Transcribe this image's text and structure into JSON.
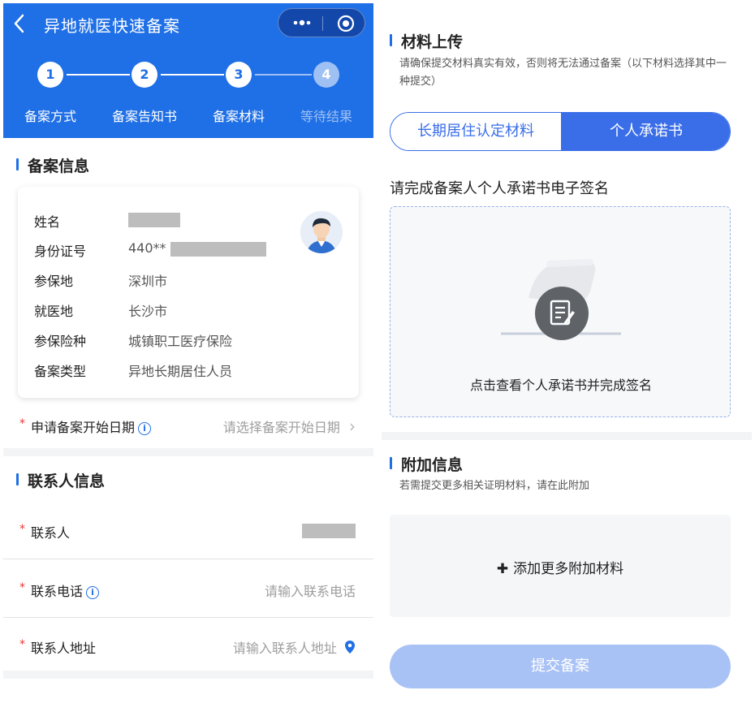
{
  "nav": {
    "title": "异地就医快速备案",
    "more_icon": "more-dots-icon",
    "close_icon": "target-close-icon"
  },
  "steps": [
    {
      "num": "1",
      "label": "备案方式",
      "state": "done"
    },
    {
      "num": "2",
      "label": "备案告知书",
      "state": "done"
    },
    {
      "num": "3",
      "label": "备案材料",
      "state": "active"
    },
    {
      "num": "4",
      "label": "等待结果",
      "state": "pending"
    }
  ],
  "record_info": {
    "title": "备案信息",
    "rows": [
      {
        "key": "姓名",
        "value": ""
      },
      {
        "key": "身份证号",
        "value": "440**"
      },
      {
        "key": "参保地",
        "value": "深圳市"
      },
      {
        "key": "就医地",
        "value": "长沙市"
      },
      {
        "key": "参保险种",
        "value": "城镇职工医疗保险"
      },
      {
        "key": "备案类型",
        "value": "异地长期居住人员"
      }
    ]
  },
  "start_date": {
    "required": "*",
    "label": "申请备案开始日期",
    "info": "i",
    "placeholder": "请选择备案开始日期",
    "chevron": "›"
  },
  "contact": {
    "title": "联系人信息",
    "name_label": "联系人",
    "phone_label": "联系电话",
    "phone_placeholder": "请输入联系电话",
    "address_label": "联系人地址",
    "address_placeholder": "请输入联系人地址",
    "required": "*",
    "info": "i"
  },
  "materials": {
    "title": "材料上传",
    "note": "请确保提交材料真实有效，否则将无法通过备案（以下材料选择其中一种提交）",
    "tab_a": "长期居住认定材料",
    "tab_b": "个人承诺书",
    "sign_prompt": "请完成备案人个人承诺书电子签名",
    "sign_action": "点击查看个人承诺书并完成签名"
  },
  "extra": {
    "title": "附加信息",
    "note": "若需提交更多相关证明材料，请在此附加",
    "add_icon": "✚",
    "add_label": "添加更多附加材料"
  },
  "submit_label": "提交备案",
  "colors": {
    "brand": "#1f6fe6",
    "segment": "#3a6ee8",
    "required": "#e53935",
    "submit_disabled": "#a9c2f5"
  }
}
